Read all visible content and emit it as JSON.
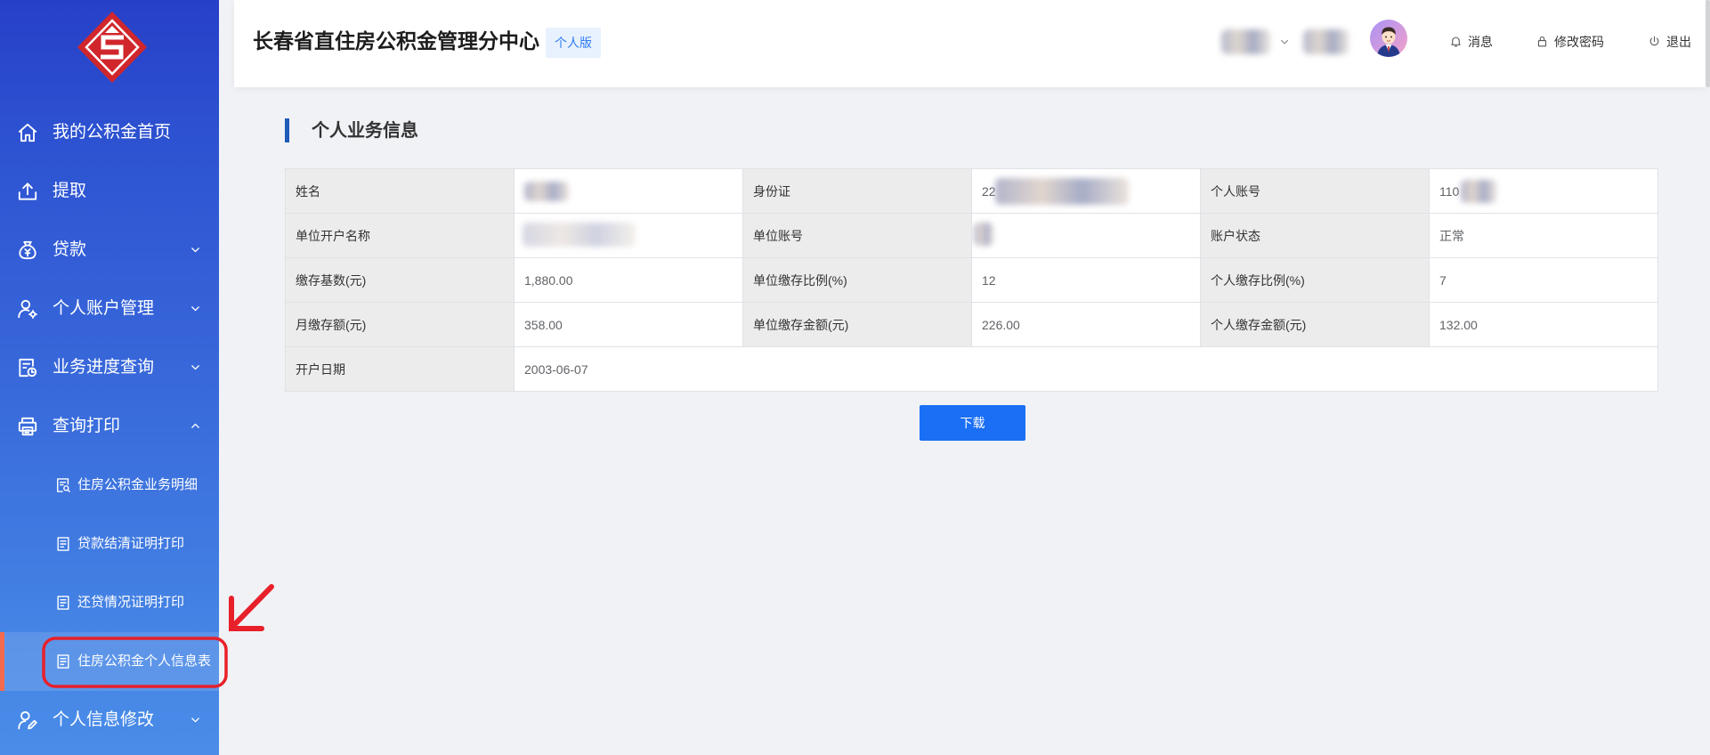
{
  "app": {
    "title": "长春省直住房公积金管理分中心",
    "edition_badge": "个人版",
    "logo_icon": "housing-fund-logo-icon"
  },
  "colors": {
    "sidebar_top": "#2740c8",
    "sidebar_bottom": "#4a8ce8",
    "active_item_accent": "#f36b4f",
    "primary_button": "#1a6ff4",
    "badge_text": "#2f7cf2",
    "section_bar": "#1e5bb8",
    "annotation_red": "#e8202a"
  },
  "sidebar": {
    "items": [
      {
        "label": "我的公积金首页",
        "icon": "home-icon"
      },
      {
        "label": "提取",
        "icon": "upload-icon"
      },
      {
        "label": "贷款",
        "icon": "loan-bag-icon",
        "chevron": "chevron-down-icon"
      },
      {
        "label": "个人账户管理",
        "icon": "user-settings-icon",
        "chevron": "chevron-down-icon"
      },
      {
        "label": "业务进度查询",
        "icon": "document-clock-icon",
        "chevron": "chevron-down-icon"
      },
      {
        "label": "查询打印",
        "icon": "printer-icon",
        "chevron": "chevron-up-icon",
        "expanded": true,
        "children": [
          {
            "label": "住房公积金业务明细",
            "icon": "document-search-icon"
          },
          {
            "label": "贷款结清证明打印",
            "icon": "document-icon"
          },
          {
            "label": "还贷情况证明打印",
            "icon": "document-icon"
          },
          {
            "label": "住房公积金个人信息表",
            "icon": "document-icon",
            "active": true
          }
        ]
      },
      {
        "label": "个人信息修改",
        "icon": "user-edit-icon",
        "chevron": "chevron-down-icon"
      }
    ]
  },
  "header": {
    "user": {
      "name_blurred": true,
      "dropdown_icon": "chevron-down-icon",
      "avatar_icon": "avatar-icon"
    },
    "actions": [
      {
        "label": "消息",
        "icon": "bell-icon"
      },
      {
        "label": "修改密码",
        "icon": "lock-icon"
      },
      {
        "label": "退出",
        "icon": "power-icon"
      }
    ]
  },
  "main": {
    "section_title": "个人业务信息",
    "info_table": {
      "rows": [
        [
          {
            "label": "姓名",
            "value": "",
            "blurred": true
          },
          {
            "label": "身份证",
            "value": "22",
            "blurred": true
          },
          {
            "label": "个人账号",
            "value": "110",
            "blurred": true
          }
        ],
        [
          {
            "label": "单位开户名称",
            "value": "",
            "blurred": true
          },
          {
            "label": "单位账号",
            "value": "",
            "blurred": true
          },
          {
            "label": "账户状态",
            "value": "正常"
          }
        ],
        [
          {
            "label": "缴存基数(元)",
            "value": "1,880.00"
          },
          {
            "label": "单位缴存比例(%)",
            "value": "12"
          },
          {
            "label": "个人缴存比例(%)",
            "value": "7"
          }
        ],
        [
          {
            "label": "月缴存额(元)",
            "value": "358.00"
          },
          {
            "label": "单位缴存金额(元)",
            "value": "226.00"
          },
          {
            "label": "个人缴存金额(元)",
            "value": "132.00"
          }
        ],
        [
          {
            "label": "开户日期",
            "value": "2003-06-07"
          }
        ]
      ]
    },
    "download_button": "下载"
  },
  "annotations": {
    "highlight_box": true,
    "arrow_icon": "red-arrow-icon"
  }
}
